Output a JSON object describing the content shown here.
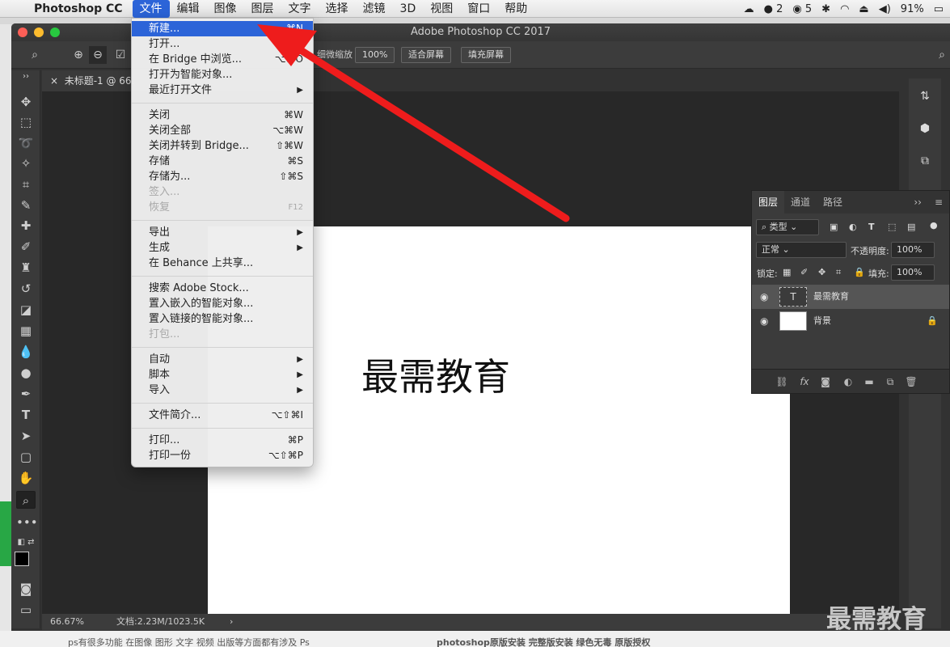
{
  "menubar": {
    "app_name": "Photoshop CC",
    "menus": [
      "文件",
      "编辑",
      "图像",
      "图层",
      "文字",
      "选择",
      "滤镜",
      "3D",
      "视图",
      "窗口",
      "帮助"
    ],
    "active_menu": "文件",
    "status": {
      "qq_count": "2",
      "wechat_count": "5",
      "battery": "91%"
    }
  },
  "window": {
    "title": "Adobe Photoshop CC 2017",
    "doc_tab": "未标题-1 @ 66.",
    "zoom_buttons": {
      "zoom_100": "100%",
      "fit_screen": "适合屏幕",
      "fill_screen": "填充屏幕"
    },
    "scrubby_zoom_label": "细微缩放"
  },
  "file_menu": {
    "items": [
      {
        "label": "新建...",
        "shortcut": "⌘N",
        "highlighted": true
      },
      {
        "label": "打开...",
        "shortcut": "⌘O"
      },
      {
        "label": "在 Bridge 中浏览...",
        "shortcut": "⌥⌘O"
      },
      {
        "label": "打开为智能对象...",
        "shortcut": ""
      },
      {
        "label": "最近打开文件",
        "submenu": "▶"
      },
      {
        "label": "关闭",
        "shortcut": "⌘W"
      },
      {
        "label": "关闭全部",
        "shortcut": "⌥⌘W"
      },
      {
        "label": "关闭并转到 Bridge...",
        "shortcut": "⇧⌘W"
      },
      {
        "label": "存储",
        "shortcut": "⌘S"
      },
      {
        "label": "存储为...",
        "shortcut": "⇧⌘S"
      },
      {
        "label": "签入...",
        "shortcut": "",
        "disabled": true
      },
      {
        "label": "恢复",
        "shortcut": "F12",
        "disabled": true
      },
      {
        "label": "导出",
        "submenu": "▶"
      },
      {
        "label": "生成",
        "submenu": "▶"
      },
      {
        "label": "在 Behance 上共享...",
        "shortcut": ""
      },
      {
        "label": "搜索 Adobe Stock...",
        "shortcut": ""
      },
      {
        "label": "置入嵌入的智能对象...",
        "shortcut": ""
      },
      {
        "label": "置入链接的智能对象...",
        "shortcut": ""
      },
      {
        "label": "打包...",
        "shortcut": "",
        "disabled": true
      },
      {
        "label": "自动",
        "submenu": "▶"
      },
      {
        "label": "脚本",
        "submenu": "▶"
      },
      {
        "label": "导入",
        "submenu": "▶"
      },
      {
        "label": "文件简介...",
        "shortcut": "⌥⇧⌘I"
      },
      {
        "label": "打印...",
        "shortcut": "⌘P"
      },
      {
        "label": "打印一份",
        "shortcut": "⌥⇧⌘P"
      }
    ]
  },
  "canvas": {
    "text": "最需教育"
  },
  "status_bar": {
    "zoom": "66.67%",
    "doc_info": "文档:2.23M/1023.5K"
  },
  "layers_panel": {
    "tabs": [
      "图层",
      "通道",
      "路径"
    ],
    "kind_filter": "类型",
    "blend_mode": "正常",
    "opacity_label": "不透明度:",
    "opacity_value": "100%",
    "lock_label": "锁定:",
    "fill_label": "填充:",
    "fill_value": "100%",
    "layers": [
      {
        "name": "最需教育",
        "type": "text",
        "thumb": "T",
        "selected": true
      },
      {
        "name": "背景",
        "type": "background",
        "locked": true
      }
    ]
  },
  "watermark": "最需教育",
  "bottom_text": {
    "left": "ps有很多功能 在图像 图形 文字 视频 出版等方面都有涉及 Ps",
    "right": "photoshop原版安装 完整版安装 绿色无毒 原版授权"
  },
  "colors": {
    "highlight": "#2c64d8",
    "arrow": "#ee1c1c",
    "ps_bg": "#282828"
  }
}
